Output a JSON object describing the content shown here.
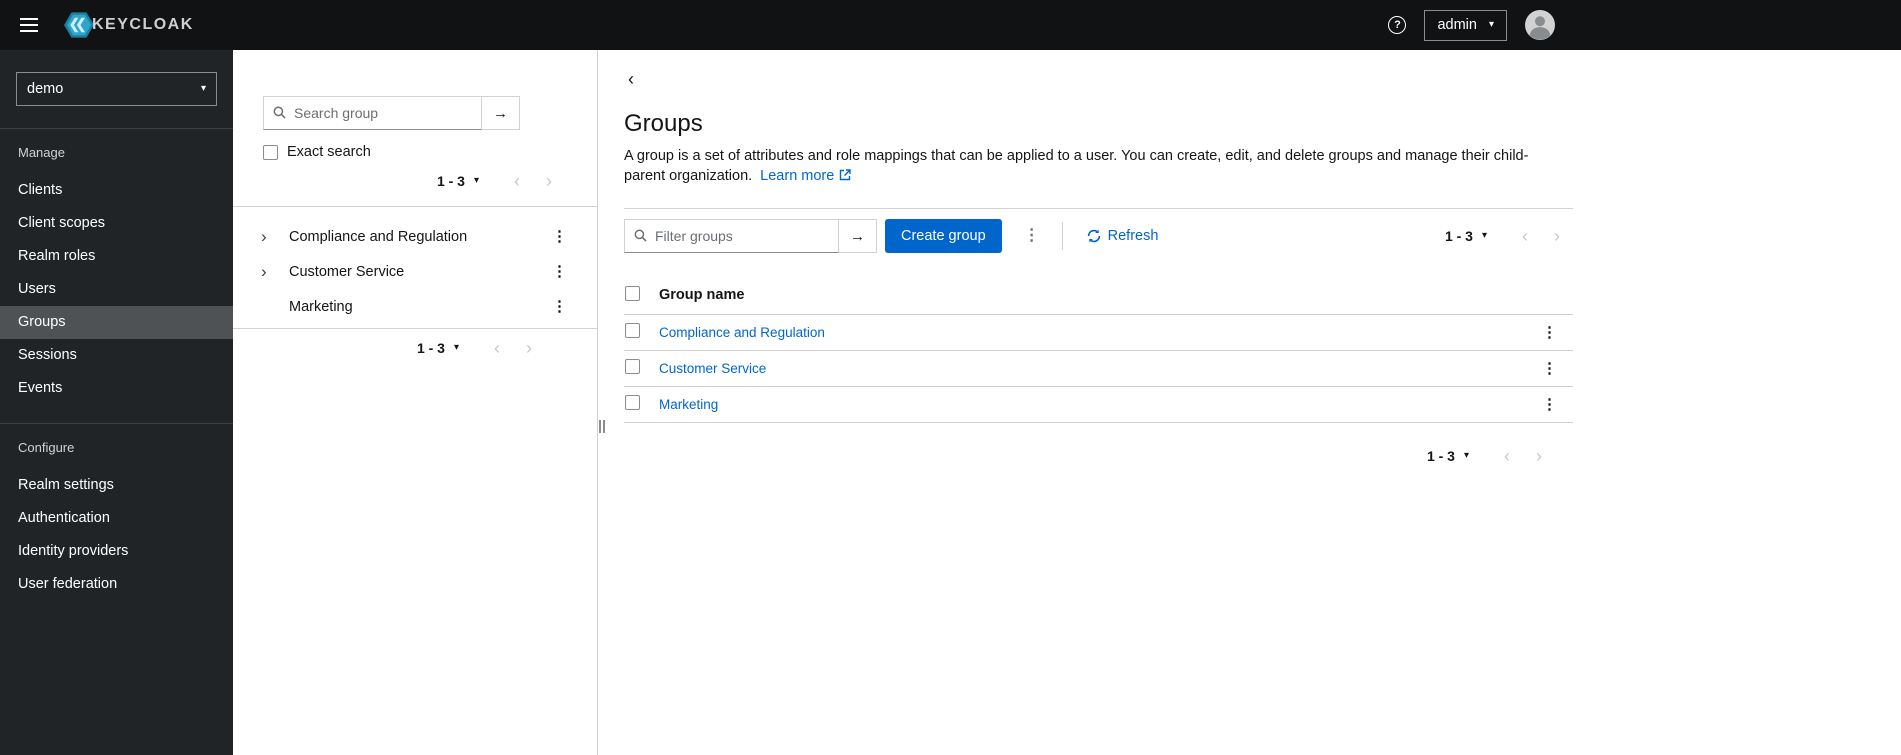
{
  "glyphs": {
    "question": "?",
    "caret_down": "▾",
    "chevron_left": "‹",
    "chevron_right": "›",
    "expand": "›",
    "back": "‹",
    "arrow_right": "→",
    "kebab": "⋮"
  },
  "masthead": {
    "brand": "KEYCLOAK",
    "username": "admin"
  },
  "sidebar": {
    "realm": "demo",
    "manage_label": "Manage",
    "configure_label": "Configure",
    "manage_items": [
      "Clients",
      "Client scopes",
      "Realm roles",
      "Users",
      "Groups",
      "Sessions",
      "Events"
    ],
    "configure_items": [
      "Realm settings",
      "Authentication",
      "Identity providers",
      "User federation"
    ],
    "active_item": "Groups"
  },
  "tree": {
    "search_placeholder": "Search group",
    "exact_search_label": "Exact search",
    "pagination": "1 - 3",
    "items": [
      {
        "label": "Compliance and Regulation",
        "expandable": true
      },
      {
        "label": "Customer Service",
        "expandable": true
      },
      {
        "label": "Marketing",
        "expandable": false
      }
    ]
  },
  "main": {
    "title": "Groups",
    "description": "A group is a set of attributes and role mappings that can be applied to a user. You can create, edit, and delete groups and manage their child-parent organization.",
    "learn_more": "Learn more",
    "toolbar": {
      "filter_placeholder": "Filter groups",
      "create_button": "Create group",
      "refresh_label": "Refresh",
      "pagination": "1 - 3"
    },
    "table": {
      "header": "Group name",
      "rows": [
        "Compliance and Regulation",
        "Customer Service",
        "Marketing"
      ]
    },
    "bottom_pagination": "1 - 3"
  },
  "colors": {
    "primary": "#0066cc",
    "link": "#0066cc",
    "masthead_bg": "#111214",
    "sidebar_bg": "#212427",
    "active_nav_bg": "#4f5255"
  }
}
